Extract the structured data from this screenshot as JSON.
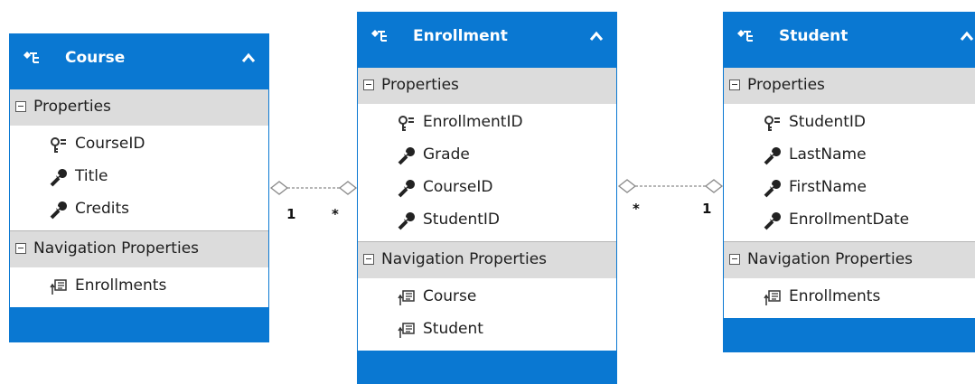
{
  "entities": [
    {
      "name": "Course",
      "sections": [
        {
          "label": "Properties",
          "items": [
            {
              "label": "CourseID",
              "icon": "key-icon"
            },
            {
              "label": "Title",
              "icon": "wrench-icon"
            },
            {
              "label": "Credits",
              "icon": "wrench-icon"
            }
          ]
        },
        {
          "label": "Navigation Properties",
          "items": [
            {
              "label": "Enrollments",
              "icon": "navigation-property-icon"
            }
          ]
        }
      ]
    },
    {
      "name": "Enrollment",
      "sections": [
        {
          "label": "Properties",
          "items": [
            {
              "label": "EnrollmentID",
              "icon": "key-icon"
            },
            {
              "label": "Grade",
              "icon": "wrench-icon"
            },
            {
              "label": "CourseID",
              "icon": "wrench-icon"
            },
            {
              "label": "StudentID",
              "icon": "wrench-icon"
            }
          ]
        },
        {
          "label": "Navigation Properties",
          "items": [
            {
              "label": "Course",
              "icon": "navigation-property-icon"
            },
            {
              "label": "Student",
              "icon": "navigation-property-icon"
            }
          ]
        }
      ]
    },
    {
      "name": "Student",
      "sections": [
        {
          "label": "Properties",
          "items": [
            {
              "label": "StudentID",
              "icon": "key-icon"
            },
            {
              "label": "LastName",
              "icon": "wrench-icon"
            },
            {
              "label": "FirstName",
              "icon": "wrench-icon"
            },
            {
              "label": "EnrollmentDate",
              "icon": "wrench-icon"
            }
          ]
        },
        {
          "label": "Navigation Properties",
          "items": [
            {
              "label": "Enrollments",
              "icon": "navigation-property-icon"
            }
          ]
        }
      ]
    }
  ],
  "associations": [
    {
      "from": "Course",
      "to": "Enrollment",
      "from_multiplicity": "1",
      "to_multiplicity": "*"
    },
    {
      "from": "Enrollment",
      "to": "Student",
      "from_multiplicity": "*",
      "to_multiplicity": "1"
    }
  ],
  "colors": {
    "header": "#0a78d2",
    "section": "#dcdcdc",
    "connector": "#8a8a8a",
    "text": "#1e1e1e"
  }
}
